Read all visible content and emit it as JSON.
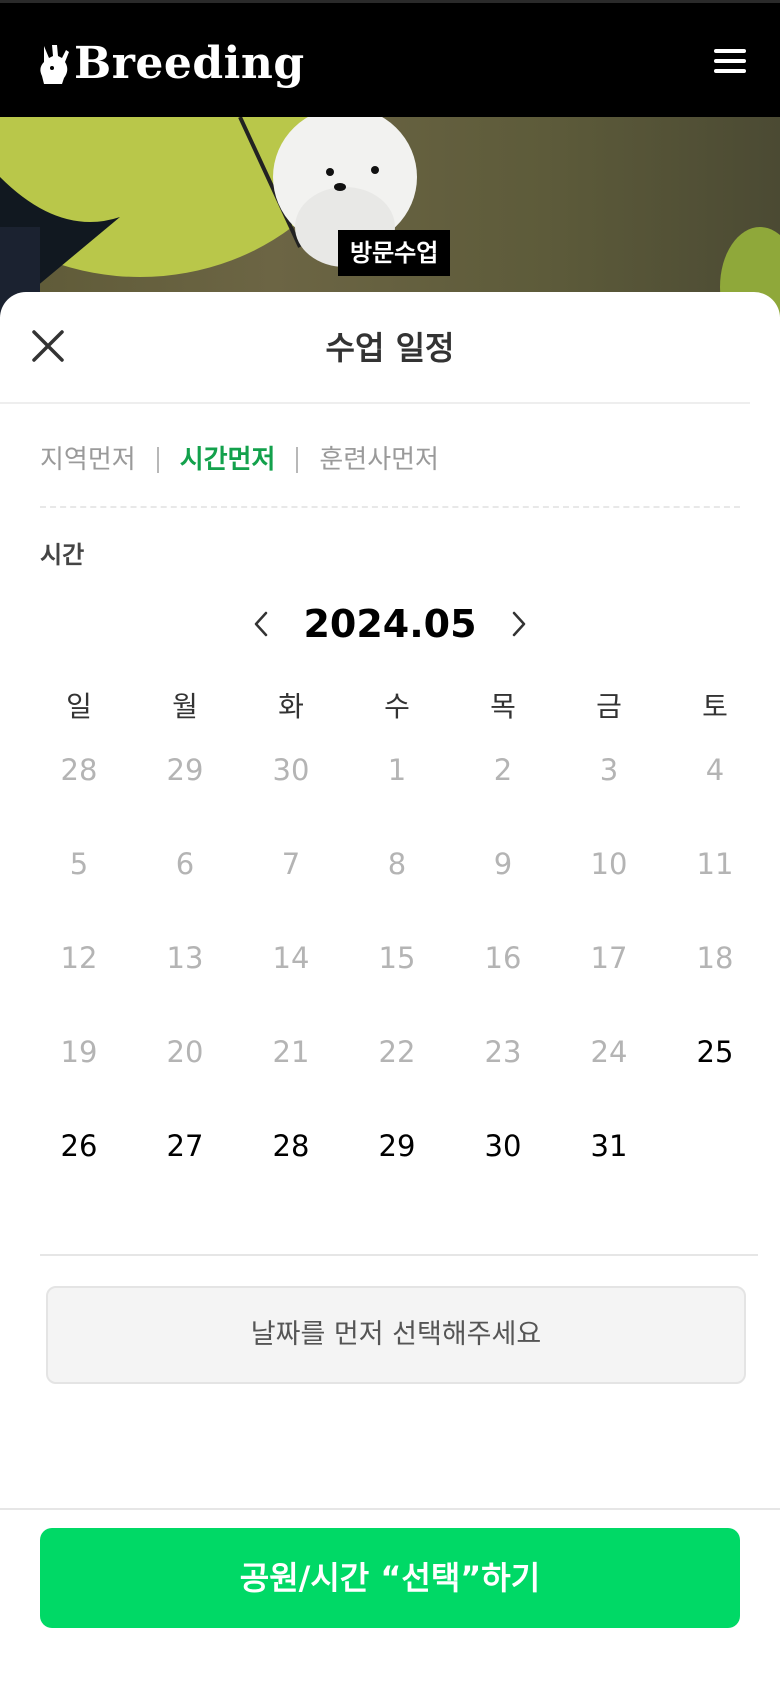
{
  "header": {
    "logo_text": "Breeding",
    "menu_icon": "hamburger-menu-icon"
  },
  "hero": {
    "badge": "방문수업"
  },
  "sheet": {
    "title": "수업 일정",
    "close_icon": "close-icon"
  },
  "filters": [
    {
      "label": "지역먼저",
      "active": false
    },
    {
      "label": "시간먼저",
      "active": true
    },
    {
      "label": "훈련사먼저",
      "active": false
    }
  ],
  "section_label": "시간",
  "calendar": {
    "month_label": "2024.05",
    "prev_icon": "chevron-left-icon",
    "next_icon": "chevron-right-icon",
    "weekdays": [
      "일",
      "월",
      "화",
      "수",
      "목",
      "금",
      "토"
    ],
    "weeks": [
      [
        {
          "d": "28",
          "a": false
        },
        {
          "d": "29",
          "a": false
        },
        {
          "d": "30",
          "a": false
        },
        {
          "d": "1",
          "a": false
        },
        {
          "d": "2",
          "a": false
        },
        {
          "d": "3",
          "a": false
        },
        {
          "d": "4",
          "a": false
        }
      ],
      [
        {
          "d": "5",
          "a": false
        },
        {
          "d": "6",
          "a": false
        },
        {
          "d": "7",
          "a": false
        },
        {
          "d": "8",
          "a": false
        },
        {
          "d": "9",
          "a": false
        },
        {
          "d": "10",
          "a": false
        },
        {
          "d": "11",
          "a": false
        }
      ],
      [
        {
          "d": "12",
          "a": false
        },
        {
          "d": "13",
          "a": false
        },
        {
          "d": "14",
          "a": false
        },
        {
          "d": "15",
          "a": false
        },
        {
          "d": "16",
          "a": false
        },
        {
          "d": "17",
          "a": false
        },
        {
          "d": "18",
          "a": false
        }
      ],
      [
        {
          "d": "19",
          "a": false
        },
        {
          "d": "20",
          "a": false
        },
        {
          "d": "21",
          "a": false
        },
        {
          "d": "22",
          "a": false
        },
        {
          "d": "23",
          "a": false
        },
        {
          "d": "24",
          "a": false
        },
        {
          "d": "25",
          "a": true
        }
      ],
      [
        {
          "d": "26",
          "a": true
        },
        {
          "d": "27",
          "a": true
        },
        {
          "d": "28",
          "a": true
        },
        {
          "d": "29",
          "a": true
        },
        {
          "d": "30",
          "a": true
        },
        {
          "d": "31",
          "a": true
        },
        {
          "d": "",
          "a": false
        }
      ]
    ]
  },
  "hint": "날짜를 먼저 선택해주세요",
  "cta_label": "공원/시간 “선택”하기",
  "colors": {
    "accent": "#00d966",
    "active_tab": "#13a14c",
    "header_bg": "#000000",
    "disabled_day": "#b4b4b4"
  }
}
